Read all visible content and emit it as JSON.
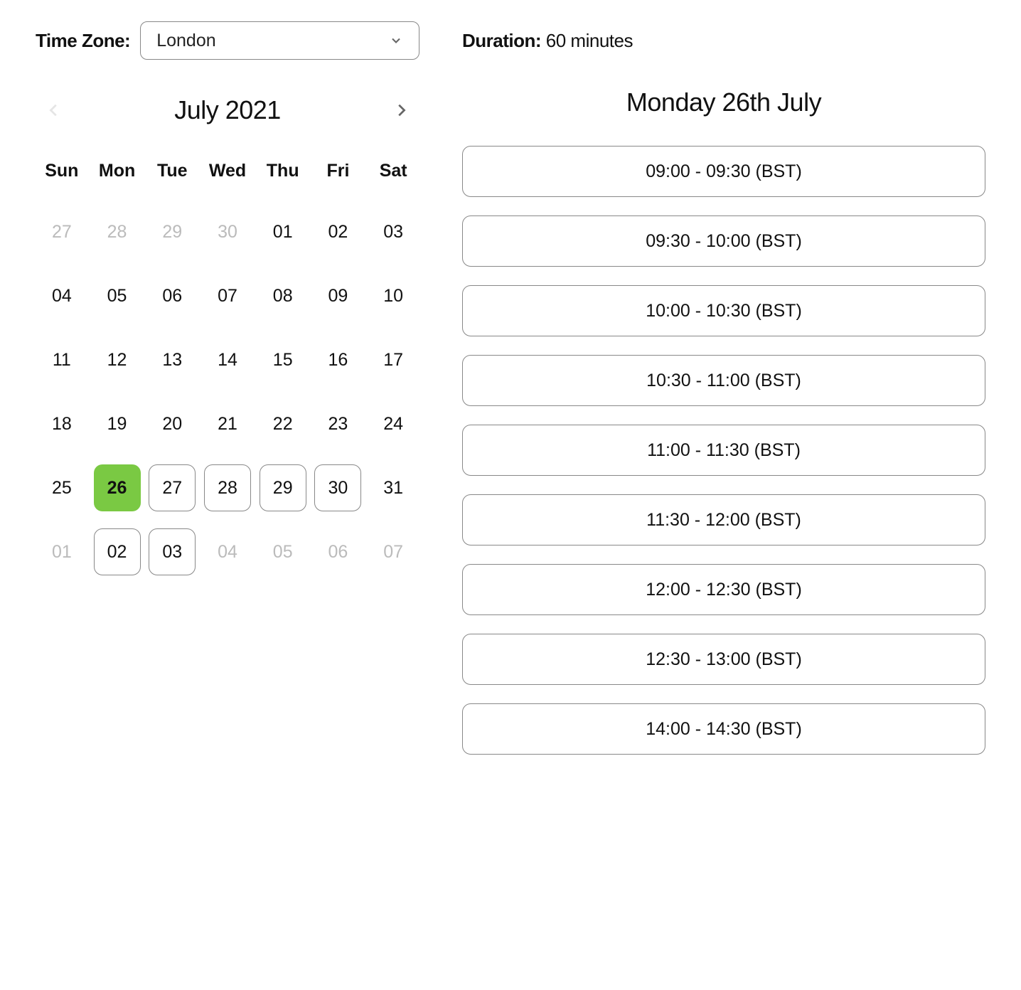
{
  "timezone": {
    "label": "Time Zone:",
    "selected": "London"
  },
  "duration": {
    "label": "Duration:",
    "value": "60 minutes"
  },
  "calendar": {
    "month_title": "July 2021",
    "dow": [
      "Sun",
      "Mon",
      "Tue",
      "Wed",
      "Thu",
      "Fri",
      "Sat"
    ],
    "days": [
      {
        "n": "27",
        "state": "muted"
      },
      {
        "n": "28",
        "state": "muted"
      },
      {
        "n": "29",
        "state": "muted"
      },
      {
        "n": "30",
        "state": "muted"
      },
      {
        "n": "01",
        "state": "normal"
      },
      {
        "n": "02",
        "state": "normal"
      },
      {
        "n": "03",
        "state": "normal"
      },
      {
        "n": "04",
        "state": "normal"
      },
      {
        "n": "05",
        "state": "normal"
      },
      {
        "n": "06",
        "state": "normal"
      },
      {
        "n": "07",
        "state": "normal"
      },
      {
        "n": "08",
        "state": "normal"
      },
      {
        "n": "09",
        "state": "normal"
      },
      {
        "n": "10",
        "state": "normal"
      },
      {
        "n": "11",
        "state": "normal"
      },
      {
        "n": "12",
        "state": "normal"
      },
      {
        "n": "13",
        "state": "normal"
      },
      {
        "n": "14",
        "state": "normal"
      },
      {
        "n": "15",
        "state": "normal"
      },
      {
        "n": "16",
        "state": "normal"
      },
      {
        "n": "17",
        "state": "normal"
      },
      {
        "n": "18",
        "state": "normal"
      },
      {
        "n": "19",
        "state": "normal"
      },
      {
        "n": "20",
        "state": "normal"
      },
      {
        "n": "21",
        "state": "normal"
      },
      {
        "n": "22",
        "state": "normal"
      },
      {
        "n": "23",
        "state": "normal"
      },
      {
        "n": "24",
        "state": "normal"
      },
      {
        "n": "25",
        "state": "normal"
      },
      {
        "n": "26",
        "state": "selected"
      },
      {
        "n": "27",
        "state": "available"
      },
      {
        "n": "28",
        "state": "available"
      },
      {
        "n": "29",
        "state": "available"
      },
      {
        "n": "30",
        "state": "available"
      },
      {
        "n": "31",
        "state": "normal"
      },
      {
        "n": "01",
        "state": "muted"
      },
      {
        "n": "02",
        "state": "available"
      },
      {
        "n": "03",
        "state": "available"
      },
      {
        "n": "04",
        "state": "muted"
      },
      {
        "n": "05",
        "state": "muted"
      },
      {
        "n": "06",
        "state": "muted"
      },
      {
        "n": "07",
        "state": "muted"
      }
    ]
  },
  "selected_date_title": "Monday 26th July",
  "slots": [
    "09:00 - 09:30 (BST)",
    "09:30 - 10:00 (BST)",
    "10:00 - 10:30 (BST)",
    "10:30 - 11:00 (BST)",
    "11:00 - 11:30 (BST)",
    "11:30 - 12:00 (BST)",
    "12:00 - 12:30 (BST)",
    "12:30 - 13:00 (BST)",
    "14:00 - 14:30 (BST)"
  ],
  "colors": {
    "accent": "#7ac943"
  }
}
